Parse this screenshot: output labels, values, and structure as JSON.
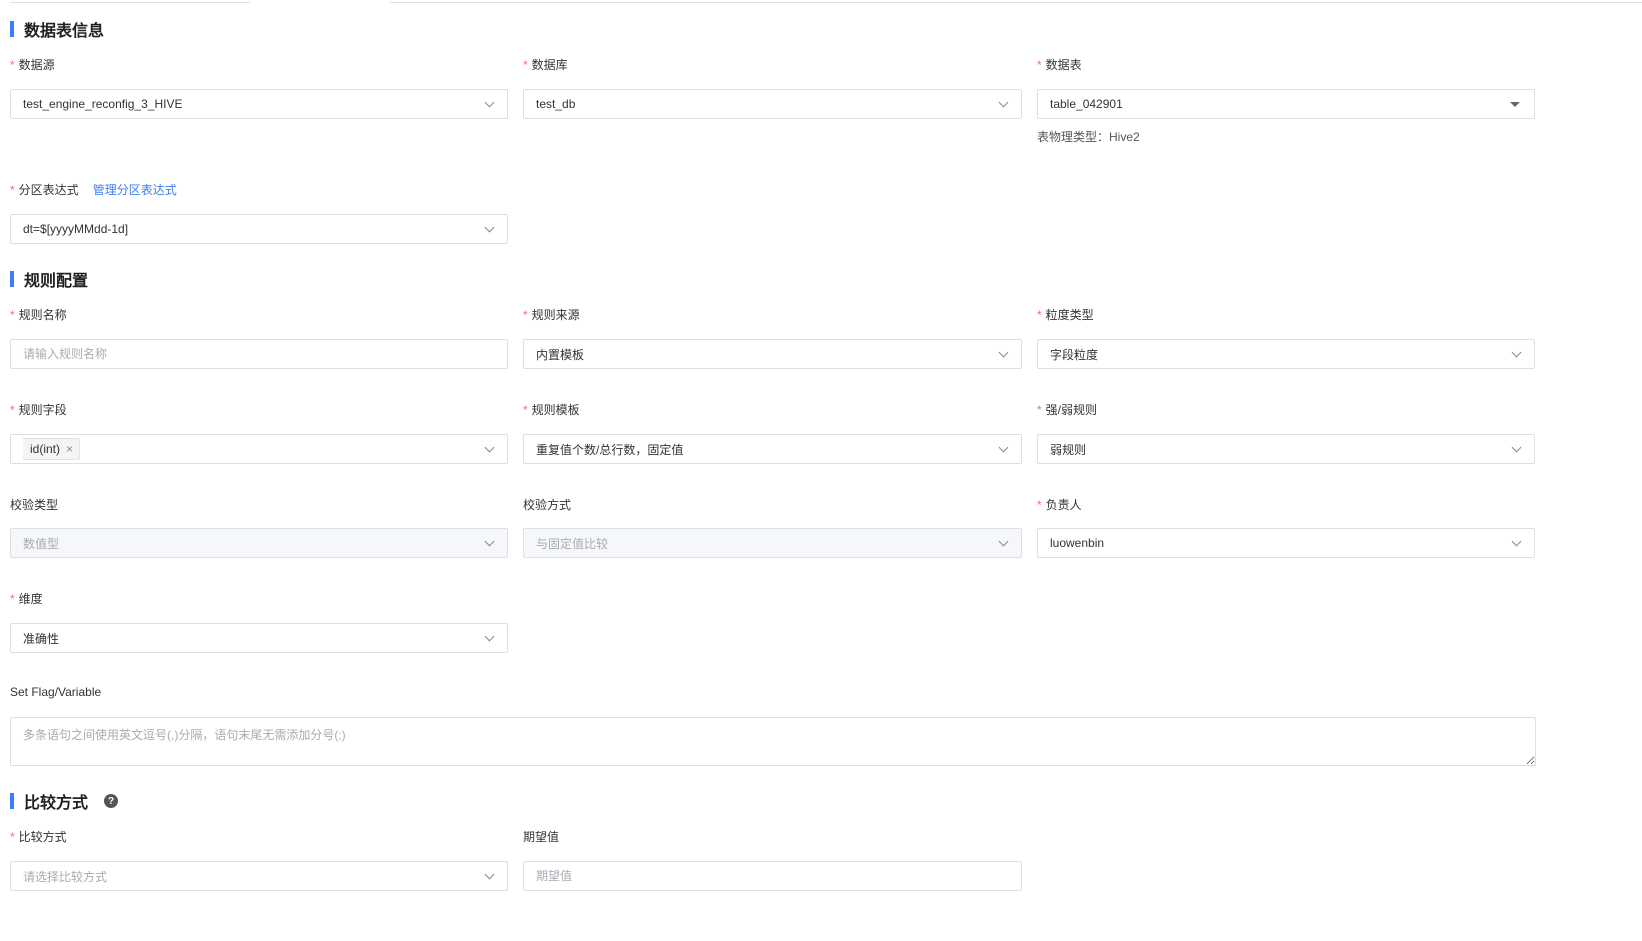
{
  "sections": {
    "table_info": "数据表信息",
    "rule_config": "规则配置",
    "compare": "比较方式"
  },
  "table_info": {
    "datasource": {
      "label": "数据源",
      "value": "test_engine_reconfig_3_HIVE"
    },
    "database": {
      "label": "数据库",
      "value": "test_db"
    },
    "table": {
      "label": "数据表",
      "value": "table_042901",
      "hint": "表物理类型：Hive2"
    },
    "partition": {
      "label": "分区表达式",
      "link": "管理分区表达式",
      "value": "dt=$[yyyyMMdd-1d]"
    }
  },
  "rule_config": {
    "rule_name": {
      "label": "规则名称",
      "placeholder": "请输入规则名称"
    },
    "rule_source": {
      "label": "规则来源",
      "value": "内置模板"
    },
    "granularity": {
      "label": "粒度类型",
      "value": "字段粒度"
    },
    "rule_field": {
      "label": "规则字段",
      "tag": "id(int)"
    },
    "rule_template": {
      "label": "规则模板",
      "value": "重复值个数/总行数，固定值"
    },
    "strength": {
      "label": "强/弱规则",
      "value": "弱规则"
    },
    "check_type": {
      "label": "校验类型",
      "value": "数值型"
    },
    "check_method": {
      "label": "校验方式",
      "value": "与固定值比较"
    },
    "owner": {
      "label": "负责人",
      "value": "luowenbin"
    },
    "dimension": {
      "label": "维度",
      "value": "准确性"
    },
    "flag": {
      "label": "Set Flag/Variable",
      "placeholder": "多条语句之间使用英文逗号(,)分隔，语句末尾无需添加分号(;)"
    }
  },
  "compare": {
    "method": {
      "label": "比较方式",
      "placeholder": "请选择比较方式"
    },
    "expected": {
      "label": "期望值",
      "placeholder": "期望值"
    }
  },
  "required_mark": "*",
  "tag_close": "×",
  "help_glyph": "?",
  "colors": {
    "accent": "#3f7cf5",
    "required": "#f56c6c"
  }
}
